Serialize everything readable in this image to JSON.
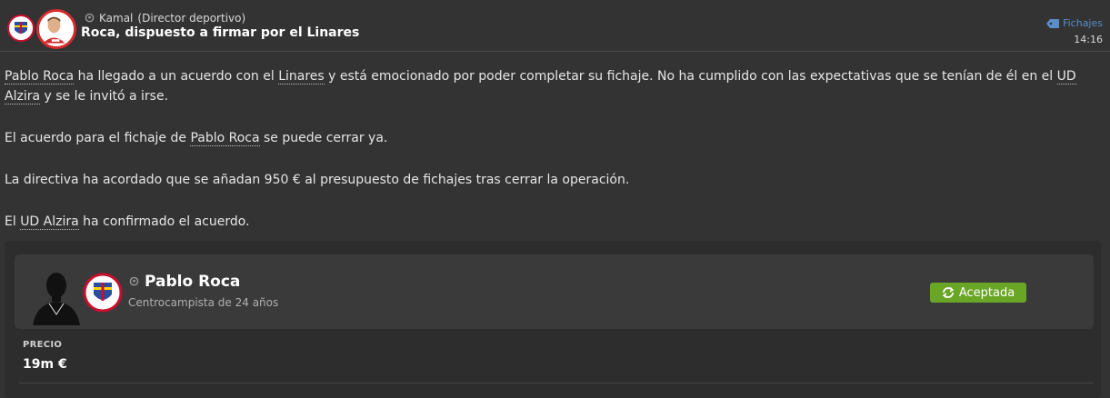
{
  "header": {
    "sender_name": "Kamal",
    "sender_role": "(Director deportivo)",
    "title": "Roca, dispuesto a firmar por el Linares",
    "tag_label": "Fichajes",
    "time": "14:16"
  },
  "body": {
    "p1": {
      "player": "Pablo Roca",
      "t1": " ha llegado a un acuerdo con el ",
      "club_new": "Linares",
      "t2": " y está emocionado por poder completar su fichaje. No ha cumplido con las expectativas que se tenían de él en el ",
      "club_old": "UD Alzira",
      "t3": " y se le invitó a irse."
    },
    "p2": {
      "t1": "El acuerdo para el fichaje de ",
      "player": "Pablo Roca",
      "t2": " se puede cerrar ya."
    },
    "p3": "La directiva ha acordado que se añadan 950 € al presupuesto de fichajes tras cerrar la operación.",
    "p4": {
      "t1": "El ",
      "club": "UD Alzira",
      "t2": " ha confirmado el acuerdo."
    }
  },
  "card": {
    "player_name": "Pablo Roca",
    "description": "Centrocampista de 24 años",
    "status": "Aceptada",
    "status_color": "#6aa626",
    "price_label": "PRECIO",
    "price_value": "19m €"
  },
  "icons": {
    "sender": "person-icon",
    "tag": "tag-icon",
    "status": "refresh-icon"
  }
}
